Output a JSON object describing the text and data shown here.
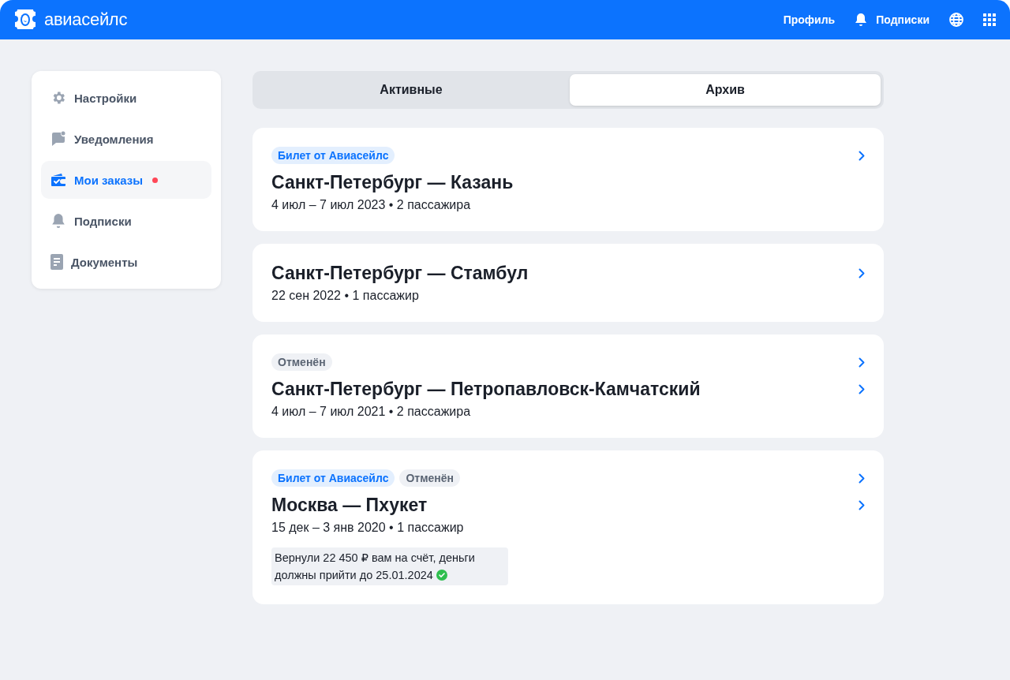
{
  "header": {
    "logo": "авиасейлс",
    "nav": [
      {
        "kind": "text",
        "label": "Профиль"
      },
      {
        "kind": "bell",
        "label": "Подписки"
      },
      {
        "kind": "globe"
      },
      {
        "kind": "grid"
      }
    ]
  },
  "sidebar": {
    "items": [
      {
        "kind": "gear",
        "label": "Настройки",
        "selected": false,
        "dot": false
      },
      {
        "kind": "chat",
        "label": "Уведомления",
        "selected": false,
        "dot": false
      },
      {
        "kind": "wallet",
        "label": "Мои заказы",
        "selected": true,
        "dot": true
      },
      {
        "kind": "bell",
        "label": "Подписки",
        "selected": false,
        "dot": false
      },
      {
        "kind": "doc",
        "label": "Документы",
        "selected": false,
        "dot": false
      }
    ]
  },
  "tabs": [
    {
      "label": "Активные",
      "selected": false
    },
    {
      "label": "Архив",
      "selected": true
    }
  ],
  "orders": [
    {
      "tags": [
        {
          "kind": "brand",
          "label": "Билет от Авиасейлс"
        }
      ],
      "tag_chevron": true,
      "title": "Санкт-Петербург — Казань",
      "title_chevron": false,
      "details": "4 июл – 7 июл 2023 • 2 пассажира"
    },
    {
      "title": "Санкт-Петербург — Стамбул",
      "title_chevron": true,
      "details": "22 сен 2022 • 1 пассажир"
    },
    {
      "tags": [
        {
          "kind": "cancelled",
          "label": "Отменён"
        }
      ],
      "tag_chevron": true,
      "title": "Санкт-Петербург — Петропавловск-Камчатский",
      "title_chevron": true,
      "details": "4 июл – 7 июл 2021 • 2 пассажира"
    },
    {
      "tags": [
        {
          "kind": "brand",
          "label": "Билет от Авиасейлс"
        },
        {
          "kind": "cancelled",
          "label": "Отменён"
        }
      ],
      "tag_chevron": true,
      "title": "Москва — Пхукет",
      "title_chevron": true,
      "details": "15 дек – 3 янв 2020 • 1 пассажир",
      "note": {
        "text": "Вернули 22 450 ₽ вам на счёт, деньги должны прийти до 25.01.2024",
        "done": true
      }
    }
  ]
}
